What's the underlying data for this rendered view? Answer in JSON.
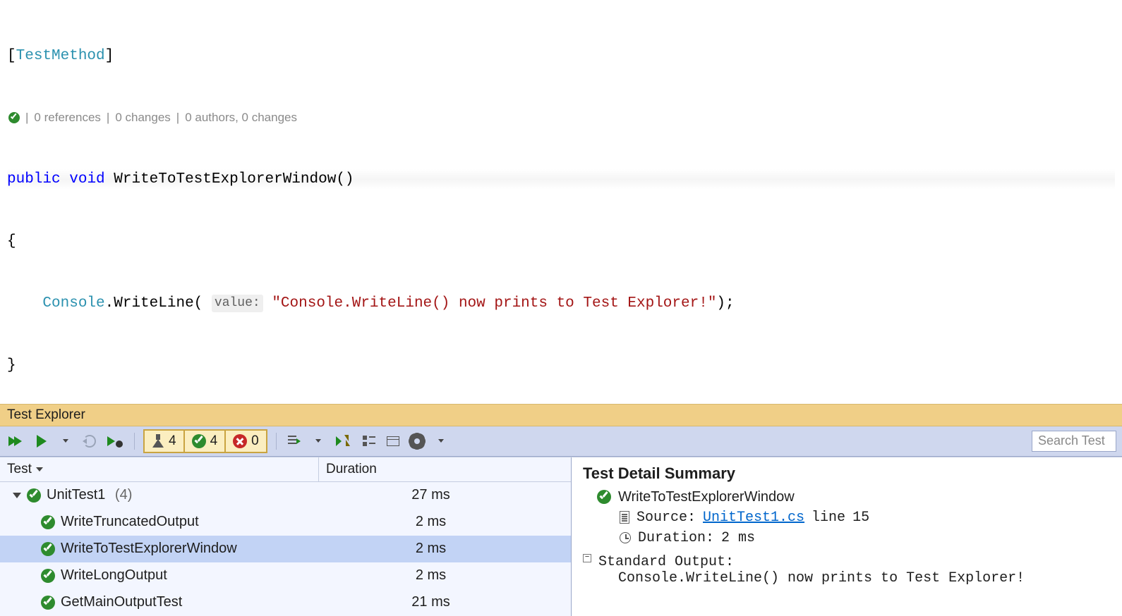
{
  "code": {
    "attribute_open": "[",
    "attribute_name": "TestMethod",
    "attribute_close": "]",
    "codelens": {
      "refs": "0 references",
      "changes": "0 changes",
      "authors": "0 authors, 0 changes"
    },
    "sig_public": "public",
    "sig_void": "void",
    "sig_name": "WriteToTestExplorerWindow",
    "sig_parens": "()",
    "brace_open": "{",
    "console_type": "Console",
    "console_dot": ".",
    "console_method": "WriteLine",
    "console_open": "(",
    "param_label": "value:",
    "string_literal": "\"Console.WriteLine() now prints to Test Explorer!\"",
    "console_close": ");",
    "brace_close": "}"
  },
  "panel": {
    "title": "Test Explorer",
    "search_placeholder": "Search Test",
    "counters": {
      "total": "4",
      "passed": "4",
      "failed": "0"
    },
    "columns": {
      "test": "Test",
      "duration": "Duration"
    },
    "group": {
      "name": "UnitTest1",
      "count": "(4)",
      "duration": "27 ms"
    },
    "tests": [
      {
        "name": "WriteTruncatedOutput",
        "duration": "2 ms",
        "selected": false
      },
      {
        "name": "WriteToTestExplorerWindow",
        "duration": "2 ms",
        "selected": true
      },
      {
        "name": "WriteLongOutput",
        "duration": "2 ms",
        "selected": false
      },
      {
        "name": "GetMainOutputTest",
        "duration": "21 ms",
        "selected": false
      }
    ]
  },
  "detail": {
    "heading": "Test Detail Summary",
    "test_name": "WriteToTestExplorerWindow",
    "source_label": "Source:",
    "source_file": "UnitTest1.cs",
    "source_line_label": "line",
    "source_line": "15",
    "duration_label": "Duration:",
    "duration_value": "2 ms",
    "stdout_label": "Standard Output:",
    "stdout_value": "Console.WriteLine() now prints to Test Explorer!"
  }
}
